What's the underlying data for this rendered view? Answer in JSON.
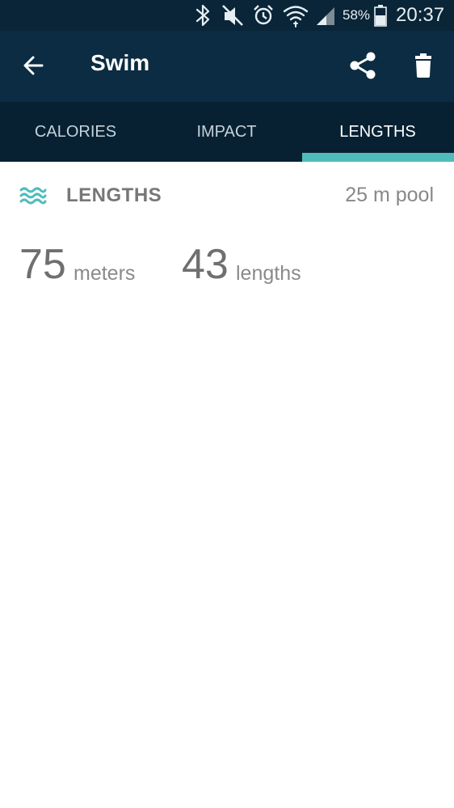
{
  "status_bar": {
    "battery_percent": "58%",
    "time": "20:37",
    "icons": [
      "bluetooth-icon",
      "mute-icon",
      "alarm-icon",
      "wifi-icon",
      "signal-icon",
      "battery-icon"
    ]
  },
  "app_bar": {
    "title": "Swim",
    "icons": [
      "back-arrow-icon",
      "share-icon",
      "trash-icon"
    ]
  },
  "tabs": [
    {
      "label": "CALORIES",
      "active": false
    },
    {
      "label": "IMPACT",
      "active": false
    },
    {
      "label": "LENGTHS",
      "active": true
    }
  ],
  "lengths_section": {
    "title": "LENGTHS",
    "pool": "25 m pool",
    "icon": "waves-icon"
  },
  "stats": {
    "meters_value": "75",
    "meters_unit": "meters",
    "lengths_value": "43",
    "lengths_unit": "lengths"
  },
  "colors": {
    "status_bar_bg": "#092537",
    "app_bar_bg": "#0b2c42",
    "tab_bar_bg": "#072133",
    "accent": "#4fbcbc"
  }
}
